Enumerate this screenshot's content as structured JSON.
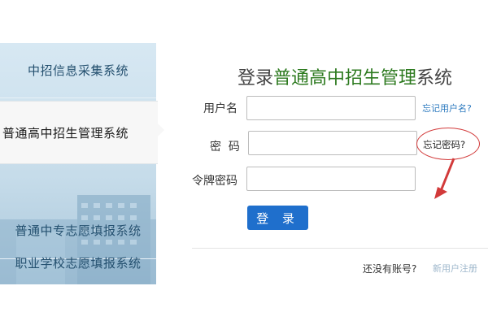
{
  "sidebar": {
    "items": [
      {
        "label": "中招信息采集系统"
      },
      {
        "label": "普通高中招生管理系统"
      },
      {
        "label": "普通中专志愿填报系统"
      },
      {
        "label": "职业学校志愿填报系统"
      }
    ]
  },
  "login": {
    "title_prefix": "登录",
    "title_highlight": "普通高中招生管理",
    "title_suffix": "系统",
    "username_label": "用户名",
    "password_label": "密  码",
    "token_label": "令牌密码",
    "username_value": "",
    "password_value": "",
    "token_value": "",
    "forgot_username": "忘记用户名?",
    "forgot_password": "忘记密码?",
    "login_button": "登 录",
    "no_account": "还没有账号?",
    "register_link": "新用户注册"
  },
  "colors": {
    "accent_blue": "#1f6fcc",
    "title_green": "#2d7a1f",
    "annotation_red": "#d23a3a"
  }
}
